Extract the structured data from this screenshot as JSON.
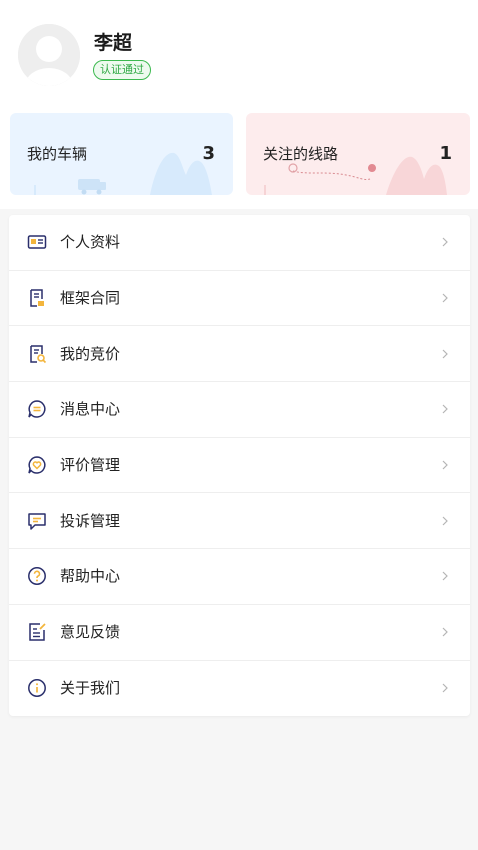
{
  "profile": {
    "name": "李超",
    "badge": "认证通过"
  },
  "stats": [
    {
      "label": "我的车辆",
      "count": "3"
    },
    {
      "label": "关注的线路",
      "count": "1"
    }
  ],
  "menu": [
    {
      "label": "个人资料",
      "icon": "id-card-icon"
    },
    {
      "label": "框架合同",
      "icon": "contract-icon"
    },
    {
      "label": "我的竞价",
      "icon": "bid-icon"
    },
    {
      "label": "消息中心",
      "icon": "message-icon"
    },
    {
      "label": "评价管理",
      "icon": "review-icon"
    },
    {
      "label": "投诉管理",
      "icon": "complaint-icon"
    },
    {
      "label": "帮助中心",
      "icon": "help-icon"
    },
    {
      "label": "意见反馈",
      "icon": "feedback-icon"
    },
    {
      "label": "关于我们",
      "icon": "info-icon"
    }
  ],
  "colors": {
    "icon_stroke": "#2a2f6b",
    "accent_yellow": "#f3b53c",
    "badge_green": "#3cb94f",
    "vehicle_card_bg": "#eaf4ff",
    "route_card_bg": "#fdeced"
  }
}
